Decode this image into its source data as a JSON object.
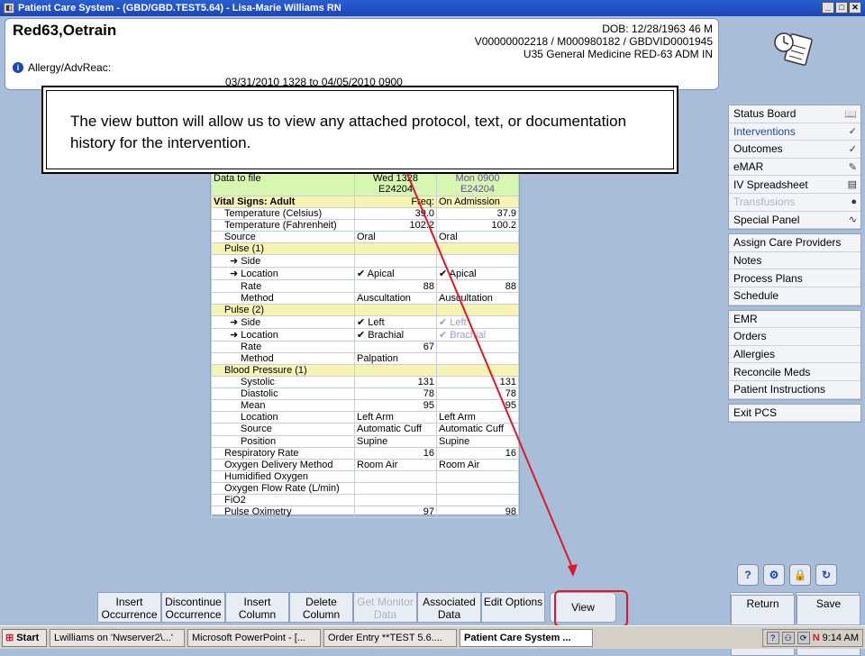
{
  "window": {
    "title": "Patient Care System - (GBD/GBD.TEST5.64) - Lisa-Marie Williams RN",
    "controls": [
      "_",
      "□",
      "✕"
    ]
  },
  "patient": {
    "name": "Red63,Oetrain",
    "dob": "DOB: 12/28/1963 46 M",
    "ids": "V00000002218 / M000980182 / GBDVID0001945",
    "location": "U35 General Medicine RED-63 ADM IN",
    "allergy_label": "Allergy/AdvReac:",
    "date_range": "03/31/2010 1328    to    04/05/2010 0900"
  },
  "callout": {
    "text": "The view button will allow us to view any attached protocol, text, or documentation history for the intervention."
  },
  "table": {
    "header": {
      "label": "Data to file",
      "col1_time": "Wed  1328",
      "col1_id": "E24204",
      "col2_time": "Mon  0900",
      "col2_id": "E24204"
    },
    "rows": [
      {
        "label": "Vital Signs: Adult",
        "v1": "Freq:",
        "v2": "On Admission",
        "type": "sec",
        "bold": true
      },
      {
        "label": "Temperature (Celsius)",
        "v1": "39.0",
        "v2": "37.9",
        "num": true
      },
      {
        "label": "Temperature (Fahrenheit)",
        "v1": "102.2",
        "v2": "100.2",
        "num": true
      },
      {
        "label": "Source",
        "v1": "Oral",
        "v2": "Oral"
      },
      {
        "label": "Pulse (1)",
        "v1": "",
        "v2": "",
        "type": "sec"
      },
      {
        "label": "➜ Side",
        "v1": "",
        "v2": ""
      },
      {
        "label": "➜ Location",
        "v1": "✔ Apical",
        "v2": "✔ Apical"
      },
      {
        "label": "Rate",
        "v1": "88",
        "v2": "88",
        "num": true
      },
      {
        "label": "Method",
        "v1": "Auscultation",
        "v2": "Auscultation"
      },
      {
        "label": "Pulse (2)",
        "v1": "",
        "v2": "",
        "type": "sec"
      },
      {
        "label": "➜ Side",
        "v1": "✔ Left",
        "v2": "✔ Left",
        "grey2": true
      },
      {
        "label": "➜ Location",
        "v1": "✔ Brachial",
        "v2": "✔ Brachial",
        "grey2": true
      },
      {
        "label": "Rate",
        "v1": "67",
        "v2": "",
        "num": true
      },
      {
        "label": "Method",
        "v1": "Palpation",
        "v2": ""
      },
      {
        "label": "Blood Pressure (1)",
        "v1": "",
        "v2": "",
        "type": "sec"
      },
      {
        "label": "Systolic",
        "v1": "131",
        "v2": "131",
        "num": true
      },
      {
        "label": "Diastolic",
        "v1": "78",
        "v2": "78",
        "num": true
      },
      {
        "label": "Mean",
        "v1": "95",
        "v2": "95",
        "num": true
      },
      {
        "label": "Location",
        "v1": "Left Arm",
        "v2": "Left Arm"
      },
      {
        "label": "Source",
        "v1": "Automatic Cuff",
        "v2": "Automatic Cuff"
      },
      {
        "label": "Position",
        "v1": "Supine",
        "v2": "Supine"
      },
      {
        "label": "Respiratory Rate",
        "v1": "16",
        "v2": "16",
        "num": true
      },
      {
        "label": "Oxygen Delivery Method",
        "v1": "Room Air",
        "v2": "Room Air"
      },
      {
        "label": "Humidified Oxygen",
        "v1": "",
        "v2": ""
      },
      {
        "label": "Oxygen Flow Rate (L/min)",
        "v1": "",
        "v2": ""
      },
      {
        "label": "FiO2",
        "v1": "",
        "v2": ""
      },
      {
        "label": "Pulse Oximetry",
        "v1": "97",
        "v2": "98",
        "num": true
      }
    ]
  },
  "sidebar": {
    "groups": [
      [
        {
          "label": "Status Board",
          "icon": "book-icon",
          "glyph": "📖"
        },
        {
          "label": "Interventions",
          "icon": "intervention-check-icon",
          "glyph": "✓",
          "selected": true
        },
        {
          "label": "Outcomes",
          "icon": "outcomes-check-icon",
          "glyph": "✓"
        },
        {
          "label": "eMAR",
          "icon": "emar-icon",
          "glyph": "✎"
        },
        {
          "label": "IV Spreadsheet",
          "icon": "iv-icon",
          "glyph": "▤"
        },
        {
          "label": "Transfusions",
          "icon": "drop-icon",
          "glyph": "●",
          "disabled": true
        },
        {
          "label": "Special Panel",
          "icon": "pulse-icon",
          "glyph": "∿"
        }
      ],
      [
        {
          "label": "Assign Care Providers"
        },
        {
          "label": "Notes"
        },
        {
          "label": "Process Plans"
        },
        {
          "label": "Schedule"
        }
      ],
      [
        {
          "label": "EMR"
        },
        {
          "label": "Orders"
        },
        {
          "label": "Allergies"
        },
        {
          "label": "Reconcile Meds"
        },
        {
          "label": "Patient Instructions"
        }
      ],
      [
        {
          "label": "Exit PCS"
        }
      ]
    ]
  },
  "toolbar": {
    "buttons": [
      {
        "label": "Insert Occurrence"
      },
      {
        "label": "Discontinue Occurrence"
      },
      {
        "label": "Insert Column"
      },
      {
        "label": "Delete Column"
      },
      {
        "label": "Get Monitor Data",
        "disabled": true
      },
      {
        "label": "Associated Data"
      },
      {
        "label": "Edit Options"
      }
    ],
    "view_label": "View",
    "return_label": "Return",
    "save_label": "Save",
    "return_glyph": "⬅",
    "save_glyph": "✔"
  },
  "icon_buttons": [
    "?",
    "⚙",
    "🔒",
    "↻"
  ],
  "taskbar": {
    "start": "Start",
    "tasks": [
      {
        "label": "Lwilliams on 'Nwserver2\\...'"
      },
      {
        "label": "Microsoft PowerPoint - [..."
      },
      {
        "label": "Order Entry **TEST 5.6...."
      },
      {
        "label": "Patient Care System ...",
        "active": true
      }
    ],
    "tray_icons": [
      "?",
      "⚇",
      "⟳"
    ],
    "tray_letter": "N",
    "time": "9:14 AM"
  },
  "colors": {
    "title_bar": "#1a46b8",
    "background": "#a8bdd8",
    "header_row": "#d7f7b0",
    "section_row": "#f7f3b3",
    "annotation_red": "#e0162b"
  }
}
